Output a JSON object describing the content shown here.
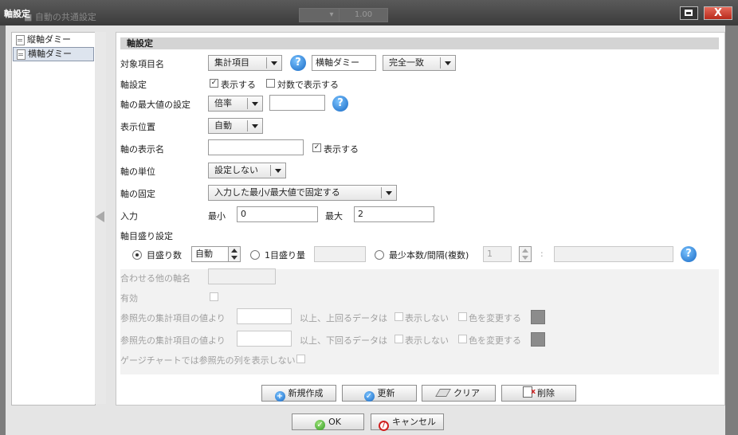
{
  "window": {
    "title": "軸設定",
    "ghost_text": "■ 自動の共通設定",
    "ghost_box1": "▾",
    "ghost_box2": "1.00",
    "close_label": "X"
  },
  "tree": {
    "items": [
      {
        "label": "縦軸ダミー"
      },
      {
        "label": "横軸ダミー"
      }
    ]
  },
  "section": {
    "header": "軸設定"
  },
  "fields": {
    "target_label": "対象項目名",
    "target_select": "集計項目",
    "target_value": "横軸ダミー",
    "match_select": "完全一致",
    "axis_setting_label": "軸設定",
    "show_label": "表示する",
    "log_label": "対数で表示する",
    "max_label": "軸の最大値の設定",
    "max_select": "倍率",
    "max_value": "",
    "position_label": "表示位置",
    "position_select": "自動",
    "display_name_label": "軸の表示名",
    "display_name_value": "",
    "display_name_show": "表示する",
    "unit_label": "軸の単位",
    "unit_select": "設定しない",
    "fix_label": "軸の固定",
    "fix_select": "入力した最小/最大値で固定する",
    "input_label": "入力",
    "min_label": "最小",
    "min_value": "0",
    "maxv_label": "最大",
    "maxv_value": "2",
    "tick_label": "軸目盛り設定",
    "tick_count_label": "目盛り数",
    "tick_count_value": "自動",
    "tick_amount_label": "1目盛り量",
    "tick_min_label": "最少本数/間隔(複数)",
    "tick_min_value": "1",
    "colon": ":"
  },
  "disabled": {
    "merge_label": "合わせる他の軸名",
    "enabled_label": "有効",
    "ref_above_label": "参照先の集計項目の値より",
    "above_text": "以上、上回るデータは",
    "ref_below_label": "参照先の集計項目の値より",
    "below_text": "以上、下回るデータは",
    "hide_label": "表示しない",
    "color_label": "色を変更する",
    "gauge_label": "ゲージチャートでは参照先の列を表示しない"
  },
  "actions": {
    "new": "新規作成",
    "update": "更新",
    "clear": "クリア",
    "delete": "削除"
  },
  "footer": {
    "ok": "OK",
    "cancel": "キャンセル"
  },
  "colors": {
    "titlebar": "#3b3b3b",
    "close": "#c8382a",
    "help": "#1668c4",
    "swatch": "#8c8c8c"
  }
}
